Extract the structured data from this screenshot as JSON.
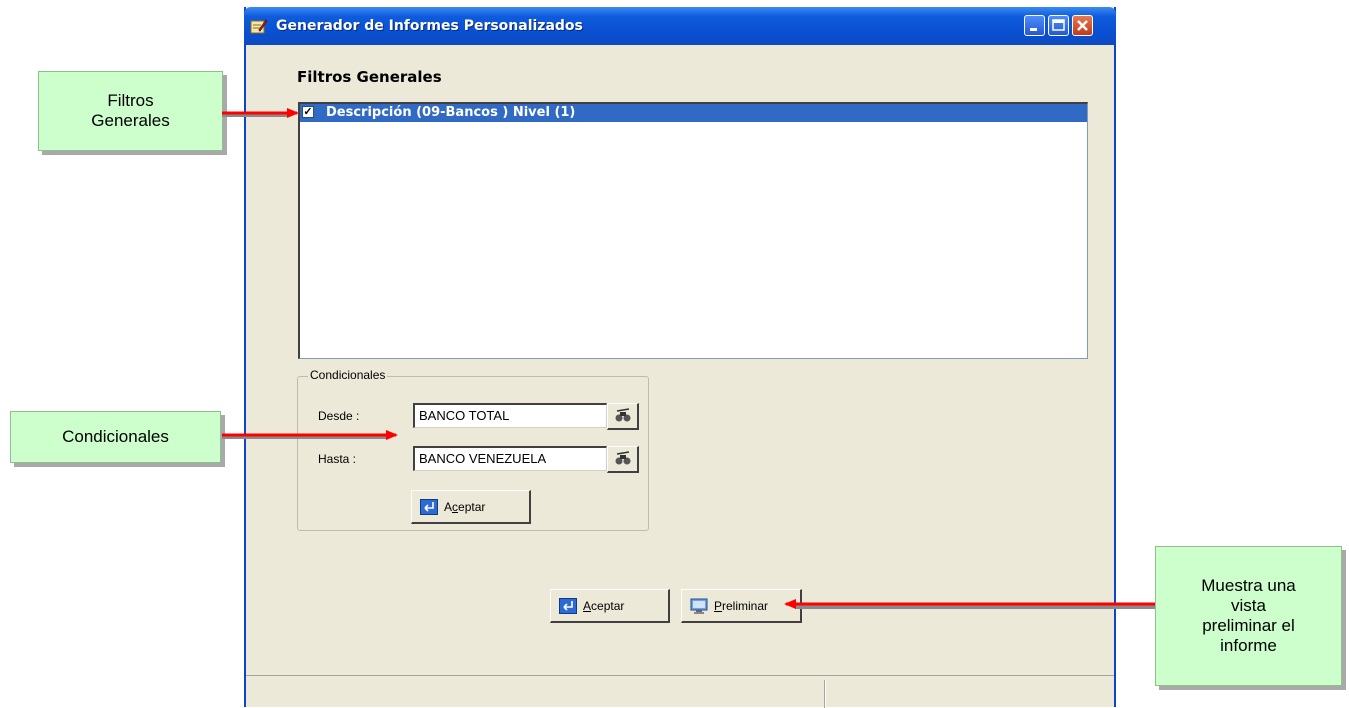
{
  "window": {
    "title": "Generador de Informes Personalizados"
  },
  "filters": {
    "heading": "Filtros Generales",
    "items": [
      {
        "label": "Descripción  (09-Bancos ) Nivel (1)",
        "checked": true
      }
    ]
  },
  "conditionals": {
    "group_label": "Condicionales",
    "from_label": "Desde :",
    "from_value": "BANCO TOTAL",
    "to_label": "Hasta :",
    "to_value": "BANCO VENEZUELA",
    "accept_pre": "A",
    "accept_mnemonic": "c",
    "accept_post": "eptar"
  },
  "footer_buttons": {
    "accept_mnemonic": "A",
    "accept_post": "ceptar",
    "preview_mnemonic": "P",
    "preview_post": "reliminar"
  },
  "callouts": {
    "filters_line1": "Filtros",
    "filters_line2": "Generales",
    "conditionals": "Condicionales",
    "preview_line1": "Muestra una",
    "preview_line2": "vista",
    "preview_line3": "preliminar el",
    "preview_line4": "informe"
  },
  "colors": {
    "callout_bg": "#ccffcc",
    "arrow": "#ff0000",
    "titlebar": "#0a4fd1",
    "selection": "#316ac5",
    "window_bg": "#ece9d8"
  }
}
